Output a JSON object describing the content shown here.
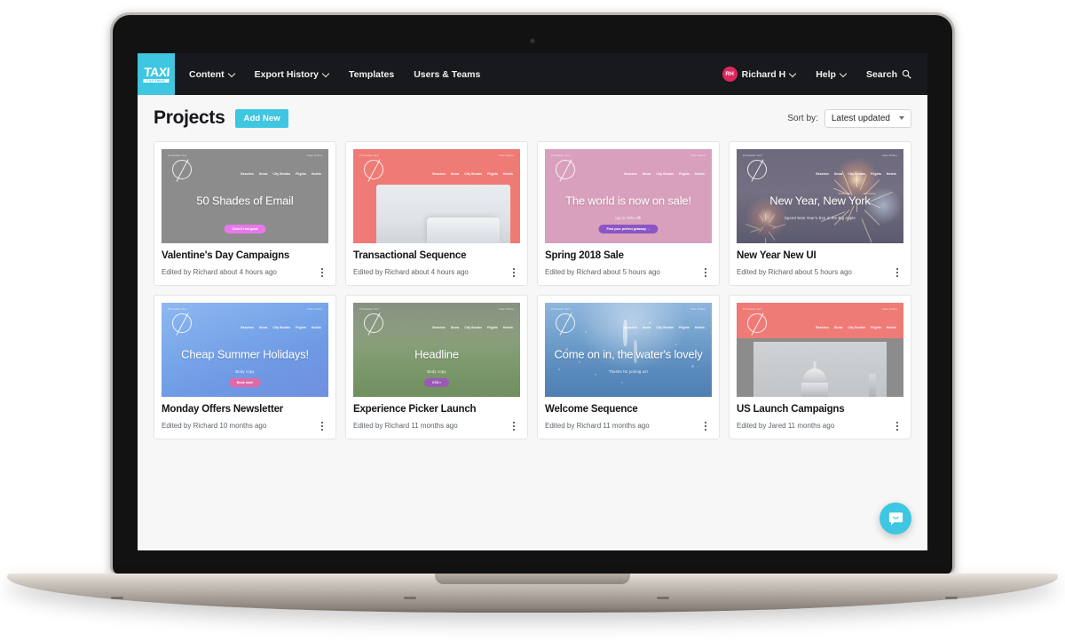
{
  "app": {
    "brand": "TAXI",
    "brand_tagline": "FOR EMAIL"
  },
  "nav": {
    "left_items": [
      {
        "label": "Content",
        "has_dropdown": true
      },
      {
        "label": "Export History",
        "has_dropdown": true
      },
      {
        "label": "Templates",
        "has_dropdown": false
      },
      {
        "label": "Users & Teams",
        "has_dropdown": false
      }
    ],
    "user": {
      "initials": "RH",
      "name": "Richard H",
      "avatar_color": "#e0245e"
    },
    "help_label": "Help",
    "search_label": "Search"
  },
  "page": {
    "title": "Projects",
    "add_new_label": "Add New",
    "sort_label": "Sort by:",
    "sort_value": "Latest updated"
  },
  "theme": {
    "accent": "#3fc6e0",
    "nav_background": "#17191c",
    "page_background": "#f7f7f7"
  },
  "projects": [
    {
      "title": "Valentine's Day Campaigns",
      "meta": "Edited by Richard about 4 hours ago",
      "scene": "grey",
      "preheader": "Preheader Text",
      "view_online": "View Online",
      "nav_links": [
        "Beaches",
        "Snow",
        "City Breaks",
        "Flights",
        "Hotels"
      ],
      "headline": "50 Shades of Email",
      "subcopy": "",
      "cta": "Click it real good",
      "cta_color": "#e878ea"
    },
    {
      "title": "Transactional Sequence",
      "meta": "Edited by Richard about 4 hours ago",
      "scene": "coral",
      "preheader": "Preheader Text",
      "view_online": "View Online",
      "nav_links": [
        "Beaches",
        "Snow",
        "City Breaks",
        "Flights",
        "Hotels"
      ],
      "headline": "",
      "subcopy": "",
      "cta": "",
      "cta_color": ""
    },
    {
      "title": "Spring 2018 Sale",
      "meta": "Edited by Richard about 5 hours ago",
      "scene": "pink",
      "preheader": "Preheader Text",
      "view_online": "View Online",
      "nav_links": [
        "Beaches",
        "Snow",
        "City Breaks",
        "Flights",
        "Hotels"
      ],
      "headline": "The world is now on sale!",
      "subcopy": "Up to 70% off!",
      "cta": "Find your perfect getaway →",
      "cta_color": "#8b55c6"
    },
    {
      "title": "New Year New UI",
      "meta": "Edited by Richard about 5 hours ago",
      "scene": "fireworks",
      "preheader": "Preheader Text",
      "view_online": "View Online",
      "nav_links": [
        "Beaches",
        "Snow",
        "City Breaks",
        "Flights",
        "Hotels"
      ],
      "headline": "New Year, New York",
      "subcopy": "Spend New Year's Eve in the Big Apple",
      "cta": "",
      "cta_color": ""
    },
    {
      "title": "Monday Offers Newsletter",
      "meta": "Edited by Richard 10 months ago",
      "scene": "sky",
      "preheader": "Preheader Text",
      "view_online": "View Online",
      "nav_links": [
        "Beaches",
        "Snow",
        "City Breaks",
        "Flights",
        "Hotels"
      ],
      "headline": "Cheap Summer Holidays!",
      "subcopy": "Body copy",
      "cta": "Book now!",
      "cta_color": "#e06aa8"
    },
    {
      "title": "Experience Picker Launch",
      "meta": "Edited by Richard 11 months ago",
      "scene": "grass",
      "preheader": "Preheader Text",
      "view_online": "View Online",
      "nav_links": [
        "Beaches",
        "Snow",
        "City Breaks",
        "Flights",
        "Hotels"
      ],
      "headline": "Headline",
      "subcopy": "Body copy",
      "cta": "CTA »",
      "cta_color": "#9b59b6"
    },
    {
      "title": "Welcome Sequence",
      "meta": "Edited by Richard 11 months ago",
      "scene": "water",
      "preheader": "Preheader Text",
      "view_online": "View Online",
      "nav_links": [
        "Beaches",
        "Snow",
        "City Breaks",
        "Flights",
        "Hotels"
      ],
      "headline": "Come on in, the water's lovely",
      "subcopy": "Thanks for joining us!",
      "cta": "",
      "cta_color": ""
    },
    {
      "title": "US Launch Campaigns",
      "meta": "Edited by Jared 11 months ago",
      "scene": "cathedral",
      "preheader": "Preheader Text",
      "view_online": "View Online",
      "nav_links": [
        "Beaches",
        "Snow",
        "City Breaks",
        "Flights",
        "Hotels"
      ],
      "headline": "",
      "subcopy": "",
      "cta": "",
      "cta_color": ""
    }
  ],
  "chat_widget": {
    "name": "intercom-launcher"
  }
}
